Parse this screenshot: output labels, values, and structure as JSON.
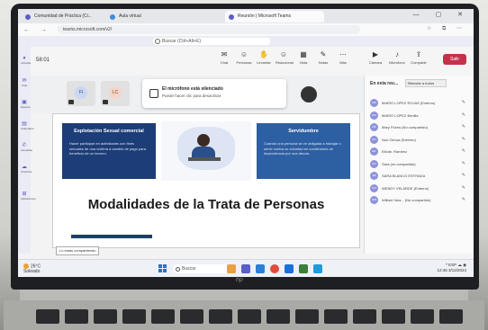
{
  "browser": {
    "tabs": [
      {
        "label": "Comunidad de Práctica (Ci...",
        "color": "#5b5fc7"
      },
      {
        "label": "Aula virtual",
        "color": "#3d8be0"
      },
      {
        "label": "Reunión | Microsoft Teams",
        "color": "#5b5fc7"
      }
    ],
    "url": "teams.microsoft.com/v2/",
    "window_controls": "—  ▢  ✕"
  },
  "teams": {
    "search_placeholder": "Buscar (Ctrl+Alt+E)",
    "timer": "58:01",
    "toolbar": [
      {
        "label": "Chat",
        "icon": "chat-icon",
        "glyph": "✉"
      },
      {
        "label": "Personas",
        "icon": "people-icon",
        "glyph": "☺"
      },
      {
        "label": "Levantar",
        "icon": "raise-hand-icon",
        "glyph": "✋"
      },
      {
        "label": "Reaccionar",
        "icon": "react-icon",
        "glyph": "☺"
      },
      {
        "label": "Vista",
        "icon": "view-icon",
        "glyph": "▦"
      },
      {
        "label": "Notas",
        "icon": "notes-icon",
        "glyph": "✎"
      },
      {
        "label": "Más",
        "icon": "more-icon",
        "glyph": "⋯"
      },
      {
        "label": "Cámara",
        "icon": "camera-icon",
        "glyph": "▶"
      },
      {
        "label": "Micrófono",
        "icon": "mic-icon",
        "glyph": "♪"
      },
      {
        "label": "Compartir",
        "icon": "share-icon",
        "glyph": "⇪"
      }
    ],
    "leave_label": "Salir",
    "rail": [
      {
        "label": "Actividad",
        "glyph": "♦"
      },
      {
        "label": "Chat",
        "glyph": "✉"
      },
      {
        "label": "Equipos",
        "glyph": "▣"
      },
      {
        "label": "Calendario",
        "glyph": "▤"
      },
      {
        "label": "Llamadas",
        "glyph": "✆"
      },
      {
        "label": "OneDrive",
        "glyph": "☁"
      },
      {
        "label": "Aplicaciones",
        "glyph": "⊞"
      }
    ]
  },
  "stage": {
    "tiles": [
      {
        "initials": "FI"
      },
      {
        "initials": "LC"
      }
    ],
    "notice_title": "El micrófono está silenciado",
    "notice_body": "Puede hacer clic para desactivar"
  },
  "participants": {
    "header": "En esta reu...",
    "dropdown": "Silenciar a todos",
    "people": [
      {
        "initials": "MR",
        "name": "MARIO LOPEZ ROJAS (Externo)"
      },
      {
        "initials": "MG",
        "name": "MARIO LOPEZ Bonilla"
      },
      {
        "initials": "MF",
        "name": "Mary Flores (No compartido)"
      },
      {
        "initials": "NO",
        "name": "Nuri Ochoa (Externo)"
      },
      {
        "initials": "ER",
        "name": "Elizab. Ramirez"
      },
      {
        "initials": "SC",
        "name": "Sara (no compartido)"
      },
      {
        "initials": "SB",
        "name": "SARA BLANCO ESTRADA"
      },
      {
        "initials": "WV",
        "name": "WENDY VELARDE (Externo)"
      },
      {
        "initials": "WM",
        "name": "Wilbert Vela... (No compartido)"
      }
    ]
  },
  "slide": {
    "card_left_title": "Explotación Sexual comercial",
    "card_left_body": "Hacer participar en actividades con fines sexuales de una víctima a cambio de pago para beneficio de un tercero.",
    "card_right_title": "Servidumbre",
    "card_right_body": "Cuando una persona se ve obligada a trabajar o servir contra su voluntad en condiciones de dependencia por una deuda.",
    "title": "Modalidades de la Trata de Personas"
  },
  "share_tag": "Lo estás compartiendo",
  "taskbar": {
    "temp": "26°C",
    "weather": "Soleado",
    "search": "Buscar",
    "time": "12:45",
    "date": "3/12/2024",
    "tray": "^  ESP  ☁  ◉"
  },
  "colors": {
    "teams_accent": "#5b5fc7",
    "slide_navy": "#1c3d77",
    "slide_blue": "#2d5fa3",
    "leave_red": "#c4314b"
  }
}
